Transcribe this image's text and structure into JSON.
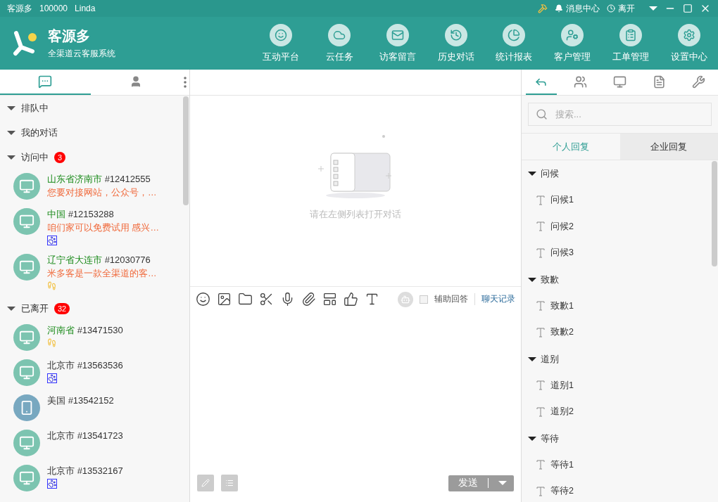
{
  "title_bar": {
    "app_name": "客源多",
    "account_id": "100000",
    "user_name": "Linda",
    "message_center": "消息中心",
    "status": "离开"
  },
  "header": {
    "brand": "客源多",
    "subtitle": "全渠道云客服系统",
    "nav": [
      {
        "label": "互动平台"
      },
      {
        "label": "云任务"
      },
      {
        "label": "访客留言"
      },
      {
        "label": "历史对话"
      },
      {
        "label": "统计报表"
      },
      {
        "label": "客户管理"
      },
      {
        "label": "工单管理"
      },
      {
        "label": "设置中心"
      }
    ]
  },
  "left_tabs": [
    {
      "selected": true
    },
    {
      "selected": false
    }
  ],
  "visitor_groups": [
    {
      "title": "排队中",
      "expanded": true
    },
    {
      "title": "我的对话",
      "expanded": true
    },
    {
      "title": "访问中",
      "expanded": true,
      "count": "3",
      "visitors": [
        {
          "name": "山东省济南市",
          "id": "#12412555",
          "online": true,
          "kind": "desktop",
          "message": "您要对接网站，公众号，…"
        },
        {
          "name": "中国",
          "id": "#12153288",
          "online": true,
          "kind": "desktop",
          "message": "咱们家可以免费试用 感兴…",
          "source": {
            "kind": "paw"
          }
        },
        {
          "name": "辽宁省大连市",
          "id": "#12030776",
          "online": true,
          "kind": "desktop",
          "message": "米多客是一款全渠道的客…",
          "source": {
            "kind": "foot"
          }
        }
      ]
    },
    {
      "title": "已离开",
      "expanded": true,
      "count": "32",
      "visitors": [
        {
          "name": "河南省",
          "id": "#13471530",
          "online": true,
          "kind": "desktop",
          "source": {
            "kind": "foot"
          }
        },
        {
          "name": "北京市",
          "id": "#13563536",
          "online": false,
          "kind": "desktop",
          "source": {
            "kind": "paw"
          }
        },
        {
          "name": "美国",
          "id": "#13542152",
          "online": false,
          "kind": "mobile"
        },
        {
          "name": "北京市",
          "id": "#13541723",
          "online": false,
          "kind": "desktop"
        },
        {
          "name": "北京市",
          "id": "#13532167",
          "online": false,
          "kind": "desktop",
          "source": {
            "kind": "paw"
          }
        }
      ]
    }
  ],
  "empty_state": {
    "text": "请在左侧列表打开对话"
  },
  "composer": {
    "assist_label": "辅助回答",
    "assist_checked": false,
    "history_link": "聊天记录",
    "send": "发送"
  },
  "right_tabs": [
    {
      "selected": true
    },
    {
      "selected": false
    },
    {
      "selected": false
    },
    {
      "selected": false
    },
    {
      "selected": false
    }
  ],
  "search": {
    "placeholder": "搜索..."
  },
  "reply_tabs": [
    {
      "label": "个人回复",
      "selected": true
    },
    {
      "label": "企业回复",
      "selected": false
    }
  ],
  "reply_groups": [
    {
      "title": "问候",
      "expanded": true,
      "items": [
        "问候1",
        "问候2",
        "问候3"
      ]
    },
    {
      "title": "致歉",
      "expanded": true,
      "items": [
        "致歉1",
        "致歉2"
      ]
    },
    {
      "title": "道别",
      "expanded": true,
      "items": [
        "道别1",
        "道别2"
      ]
    },
    {
      "title": "等待",
      "expanded": true,
      "items": [
        "等待1",
        "等待2"
      ]
    }
  ]
}
